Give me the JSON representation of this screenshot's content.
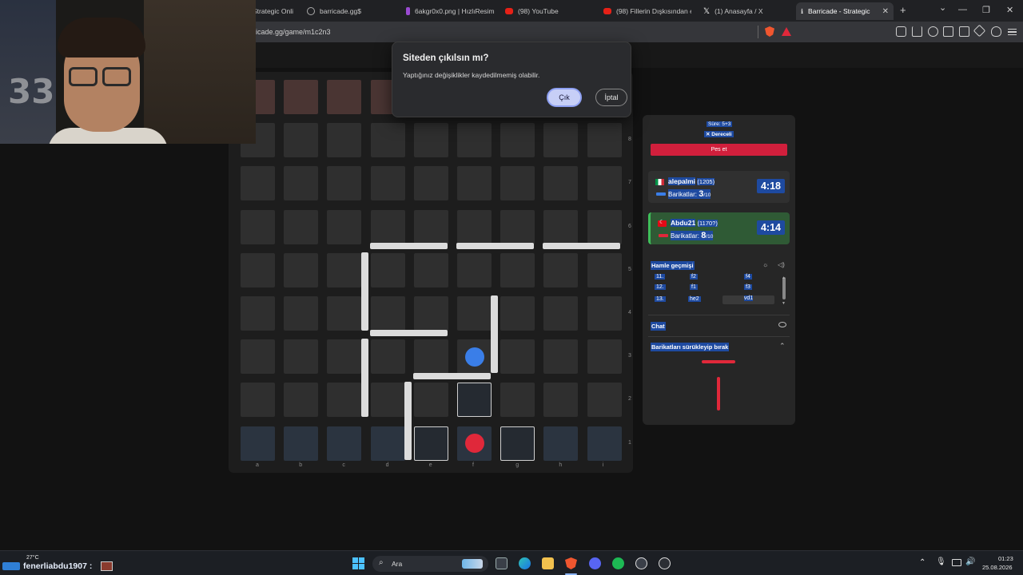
{
  "browser": {
    "tabs": [
      {
        "label": "Strategic Onli",
        "icon_color": "#888888"
      },
      {
        "label": "barricade.gg$",
        "icon_color": "#aaaaaa"
      },
      {
        "label": "6akgr0x0.png | HızlıResim",
        "icon_color": "#9a4ad1"
      },
      {
        "label": "(98) YouTube",
        "icon_color": "#e62117"
      },
      {
        "label": "(98) Fillerin Dışkısından e",
        "icon_color": "#e62117"
      },
      {
        "label": "(1) Anasayfa / X",
        "icon_color": "#ffffff"
      },
      {
        "label": "Barricade - Strategic",
        "icon_color": "#cccccc"
      }
    ],
    "url": "icade.gg/game/m1c2n3",
    "new_tab": "+",
    "tab_close": "✕",
    "win_min": "—",
    "win_max": "❐",
    "win_close": "✕",
    "chevron": "⌄"
  },
  "dialog": {
    "title": "Siteden çıkılsın mı?",
    "message": "Yaptığınız değişiklikler kaydedilmemiş olabilir.",
    "ok_label": "Çık",
    "cancel_label": "İptal"
  },
  "board": {
    "rows": [
      "8",
      "7",
      "6",
      "5",
      "4",
      "3",
      "2",
      "1"
    ],
    "cols": [
      "a",
      "b",
      "c",
      "d",
      "e",
      "f",
      "g",
      "h",
      "i"
    ],
    "colors": {
      "top": "#4a3533",
      "bottom": "#2b3440",
      "cell": "#2f2f2f",
      "wall": "#dcdcdc"
    },
    "pawns": [
      {
        "player": "alepalmi",
        "color": "#3a7ee8",
        "square": "f3"
      },
      {
        "player": "Abdu21",
        "color": "#e0283a",
        "square": "f1"
      }
    ],
    "selected_squares": [
      "f2",
      "e1",
      "g1"
    ]
  },
  "panel": {
    "time_control": "Süre: 5+3",
    "rated": "✕ Dereceli",
    "resign_label": "Pes et",
    "players": [
      {
        "name": "alepalmi",
        "rating": "(1205)",
        "barricades_label": "Barikatlar:",
        "barricades": "3",
        "barricades_max": "/10",
        "clock": "4:18",
        "bar_color": "#3a7ee8",
        "clock_bg": "#1e4aa0",
        "card_bg": "#303030",
        "active": false
      },
      {
        "name": "Abdu21",
        "rating": "(1170?)",
        "barricades_label": "Barikatlar:",
        "barricades": "8",
        "barricades_max": "/10",
        "clock": "4:14",
        "bar_color": "#e0283a",
        "clock_bg": "#1e4aa0",
        "card_bg": "#2f5a35",
        "active": true
      }
    ],
    "history_title": "Hamle geçmişi",
    "moves": [
      {
        "num": "11.",
        "white": "f2",
        "black": "f4"
      },
      {
        "num": "12.",
        "white": "f1",
        "black": "f3"
      },
      {
        "num": "13.",
        "white": "he2",
        "black": "vd1"
      }
    ],
    "chat_title": "Chat",
    "drag_title": "Barikatları sürükleyip bırak",
    "chevron_up": "⌃"
  },
  "taskbar": {
    "weather_temp": "27°C",
    "overlay_user": "fenerliabdu1907 :",
    "search_label": "Ara",
    "time": "01:23",
    "date": "25.08.2026"
  }
}
